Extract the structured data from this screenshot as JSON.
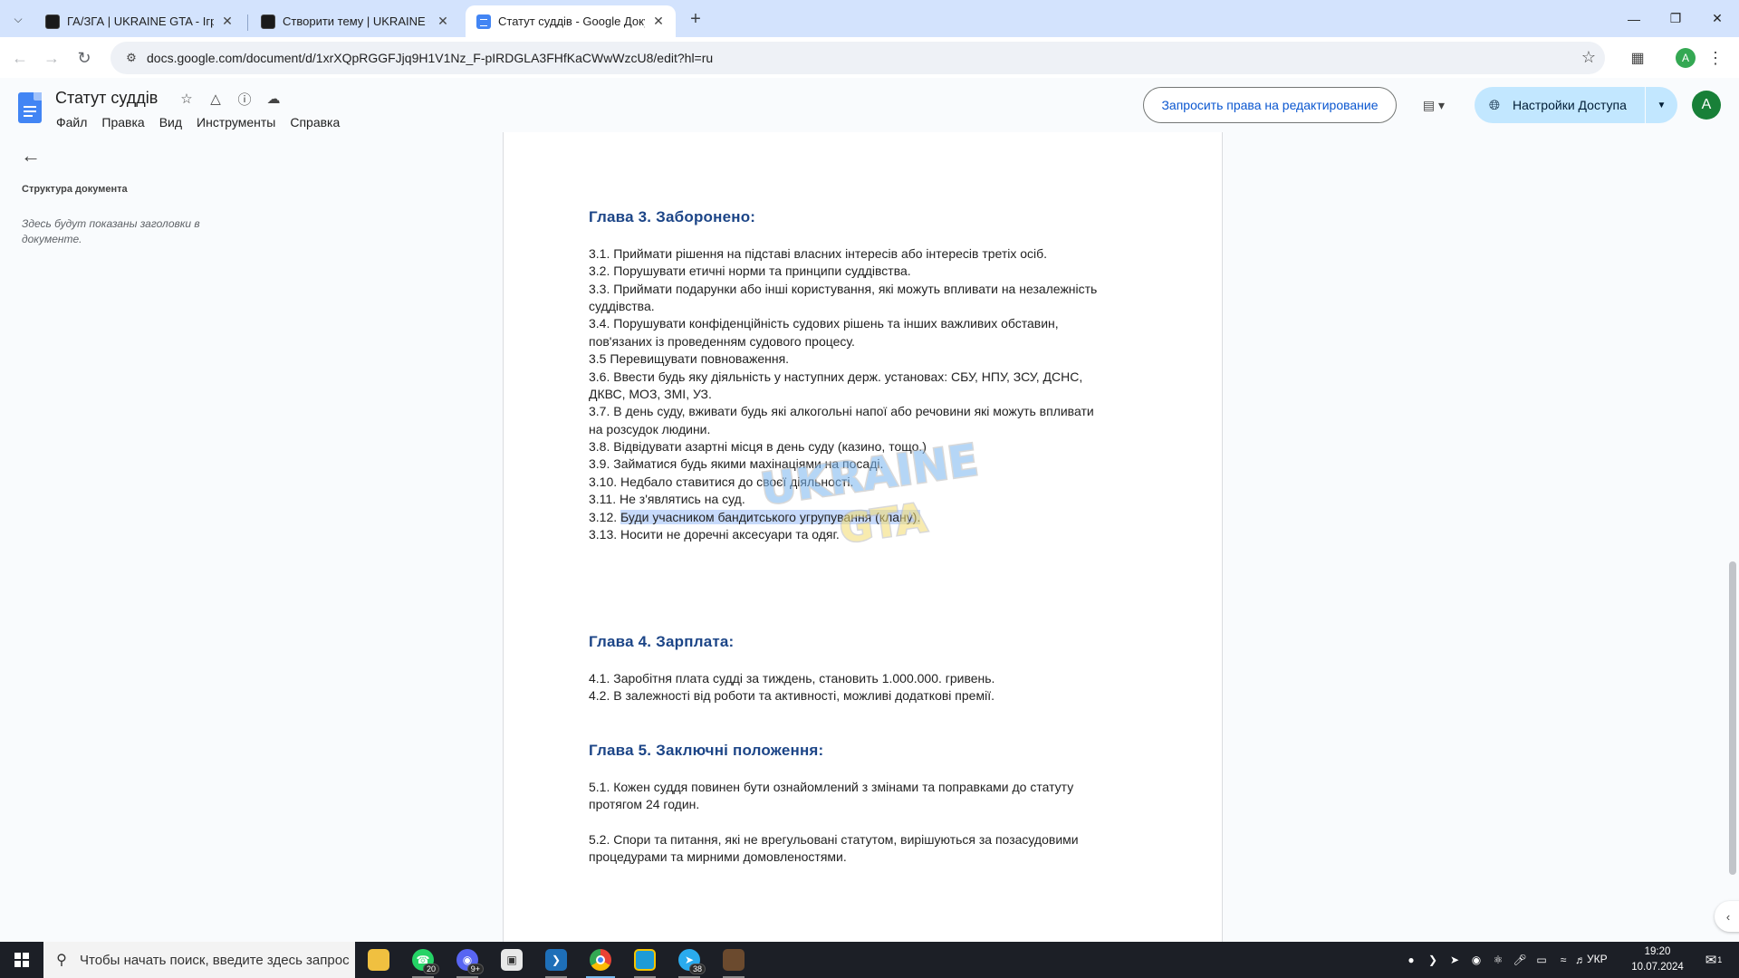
{
  "browser": {
    "tabs": [
      {
        "title": "ГА/ЗГА | UKRAINE GTA - Ігрові",
        "favicon": "gta-favicon-icon"
      },
      {
        "title": "Створити тему | UKRAINE GTA",
        "favicon": "gta-favicon-icon"
      },
      {
        "title": "Статут суддів - Google Докуме",
        "favicon": "google-docs-favicon-icon"
      }
    ],
    "url": "docs.google.com/document/d/1xrXQpRGGFJjq9H1V1Nz_F-pIRDGLA3FHfKaCWwWzcU8/edit?hl=ru",
    "profile_initial": "A"
  },
  "docs": {
    "title": "Статут суддів",
    "menu": [
      "Файл",
      "Правка",
      "Вид",
      "Инструменты",
      "Справка"
    ],
    "request_edit_label": "Запросить права на редактирование",
    "share_label": "Настройки Доступа",
    "account_initial": "A"
  },
  "outline": {
    "title": "Структура документа",
    "hint": "Здесь будут показаны заголовки в документе."
  },
  "document": {
    "ch3_heading": "Глава 3. Заборонено:",
    "ch3_lines": [
      "3.1. Приймати рішення на підставі власних інтересів або інтересів третіх осіб.",
      "3.2. Порушувати етичні норми та принципи суддівства.",
      "3.3. Приймати подарунки або інші користування, які можуть впливати на незалежність",
      "суддівства.",
      "3.4. Порушувати конфіденційність судових рішень та інших важливих обставин,",
      "пов'язаних із проведенням судового процесу.",
      "3.5 Перевищувати повноваження.",
      "3.6. Ввести будь яку діяльність у наступних держ. установах: СБУ, НПУ, ЗСУ, ДСНС,",
      "ДКВС, МОЗ, ЗМІ, УЗ.",
      "3.7. В день суду, вживати будь які алкогольні напої або речовини які можуть впливати",
      "на розсудок людини.",
      "3.8. Відвідувати азартні місця в день суду (казино, тощо.)",
      "3.9. Займатися будь якими махінаціями на посаді.",
      "3.10. Недбало ставитися до своєї діяльності.",
      "3.11. Не з'являтись на суд."
    ],
    "ch3_312_prefix": "3.12. ",
    "ch3_312_selected": "Буди учасником бандитського угрупування (клану).",
    "ch3_313": "3.13. Носити не доречні аксесуари та одяг.",
    "ch4_heading": "Глава 4. Зарплата:",
    "ch4_lines": [
      "4.1. Заробітня плата судді за тиждень, становить 1.000.000. гривень.",
      "4.2. В залежності від роботи та активності, можливі додаткові премії."
    ],
    "ch5_heading": "Глава 5. Заключні положення:",
    "ch5_lines": [
      "5.1. Кожен суддя повинен бути ознайомлений з змінами та поправками до статуту",
      "протягом 24 годин.",
      "5.2. Спори та питання, які не врегульовані статутом, вирішуються за позасудовими",
      "процедурами та мирними домовленостями."
    ],
    "watermark_text": [
      "UKRAINE",
      "GTA"
    ]
  },
  "taskbar": {
    "search_placeholder": "Чтобы начать поиск, введите здесь запрос",
    "whatsapp_badge": "20",
    "discord_badge": "9+",
    "telegram_badge": "38",
    "language": "УКР",
    "time": "19:20",
    "date": "10.07.2024",
    "notifications": "1"
  },
  "colors": {
    "heading": "#1c4587",
    "selection": "#c7dafb",
    "share_button": "#c2e7ff",
    "tabstrip": "#d3e3fd"
  }
}
